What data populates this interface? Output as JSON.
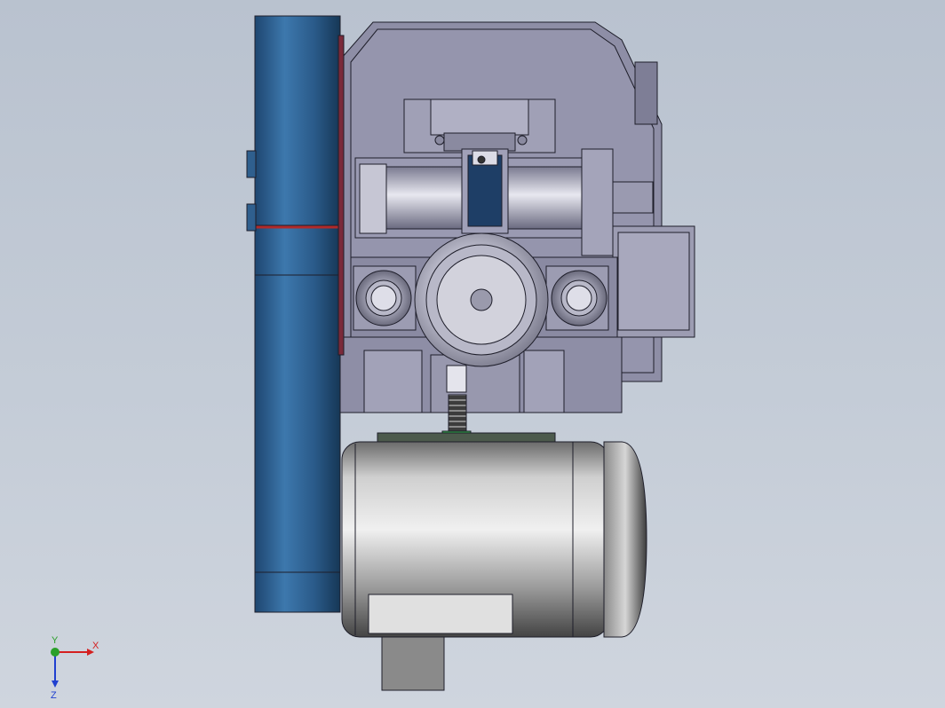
{
  "viewport": {
    "background_top": "#b9c2cf",
    "background_bottom": "#cfd5de"
  },
  "model": {
    "colors": {
      "pulley_blue": "#2f5f8e",
      "pulley_dark": "#183a5c",
      "housing": "#8e8ea6",
      "housing_light": "#b4b4c8",
      "housing_dark": "#6a6a80",
      "steel": "#c9c9d4",
      "motor_light": "#d8d8d8",
      "motor_dark": "#5a5a5a",
      "accent_red": "#b02a2a",
      "accent_green": "#33b04a",
      "edge": "#1e1e2a"
    }
  },
  "triad": {
    "x_label": "X",
    "y_label": "Y",
    "z_label": "Z",
    "x_color": "#d42020",
    "y_color": "#2aa02a",
    "z_color": "#2040d0"
  }
}
